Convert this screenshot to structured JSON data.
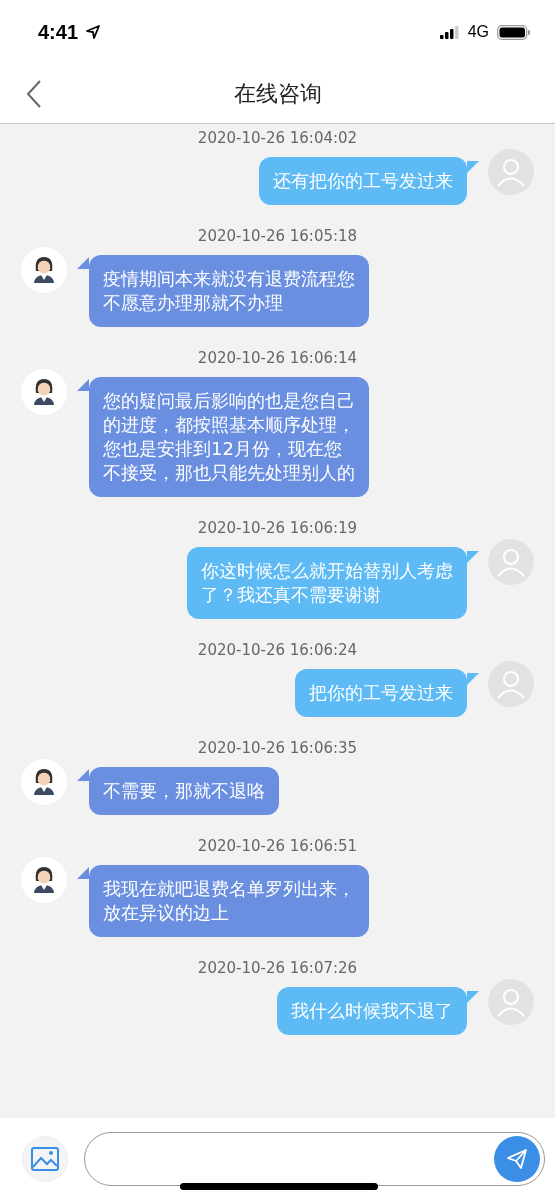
{
  "status_bar": {
    "time": "4:41",
    "network": "4G"
  },
  "nav": {
    "title": "在线咨询"
  },
  "messages": [
    {
      "time": "2020-10-26 16:04:02",
      "kind": "sent",
      "text": "还有把你的工号发过来"
    },
    {
      "time": "2020-10-26 16:05:18",
      "kind": "received",
      "text": "疫情期间本来就没有退费流程您不愿意办理那就不办理"
    },
    {
      "time": "2020-10-26 16:06:14",
      "kind": "received",
      "text": "您的疑问最后影响的也是您自己的进度，都按照基本顺序处理，您也是安排到12月份，现在您不接受，那也只能先处理别人的"
    },
    {
      "time": "2020-10-26 16:06:19",
      "kind": "sent",
      "text": "你这时候怎么就开始替别人考虑了？我还真不需要谢谢"
    },
    {
      "time": "2020-10-26 16:06:24",
      "kind": "sent",
      "text": "把你的工号发过来"
    },
    {
      "time": "2020-10-26 16:06:35",
      "kind": "received",
      "text": "不需要，那就不退咯"
    },
    {
      "time": "2020-10-26 16:06:51",
      "kind": "received",
      "text": "我现在就吧退费名单罗列出来，放在异议的边上"
    },
    {
      "time": "2020-10-26 16:07:26",
      "kind": "sent",
      "text": "我什么时候我不退了"
    }
  ]
}
